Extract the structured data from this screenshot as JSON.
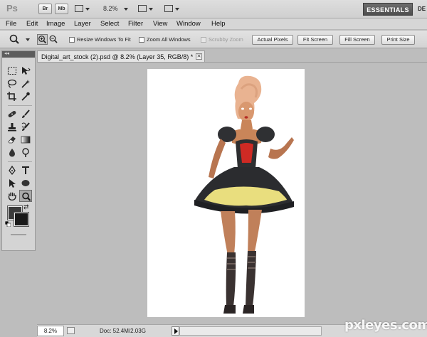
{
  "app_bar": {
    "logo": "Ps",
    "bridge_label": "Br",
    "minibridge_label": "Mb",
    "zoom_level": "8.2%",
    "workspace": "ESSENTIALS",
    "workspace_more": "DE"
  },
  "menu": {
    "items": [
      "File",
      "Edit",
      "Image",
      "Layer",
      "Select",
      "Filter",
      "View",
      "Window",
      "Help"
    ]
  },
  "options_bar": {
    "resize_windows_label": "Resize Windows To Fit",
    "zoom_all_label": "Zoom All Windows",
    "scrubby_zoom_label": "Scrubby Zoom",
    "actual_pixels_label": "Actual Pixels",
    "fit_screen_label": "Fit Screen",
    "fill_screen_label": "Fill Screen",
    "print_size_label": "Print Size"
  },
  "tools_panel": {
    "collapse_glyph": "◂◂",
    "foreground_color": "#3b3b3b",
    "background_color": "#1a1a1a"
  },
  "document": {
    "tab_title": "Digital_art_stock (2).psd @ 8.2% (Layer 35, RGB/8) *",
    "close_glyph": "✕"
  },
  "status_bar": {
    "zoom": "8.2%",
    "doc_info": "Doc: 52.4M/2.03G"
  },
  "watermark": "pxleyes.com"
}
